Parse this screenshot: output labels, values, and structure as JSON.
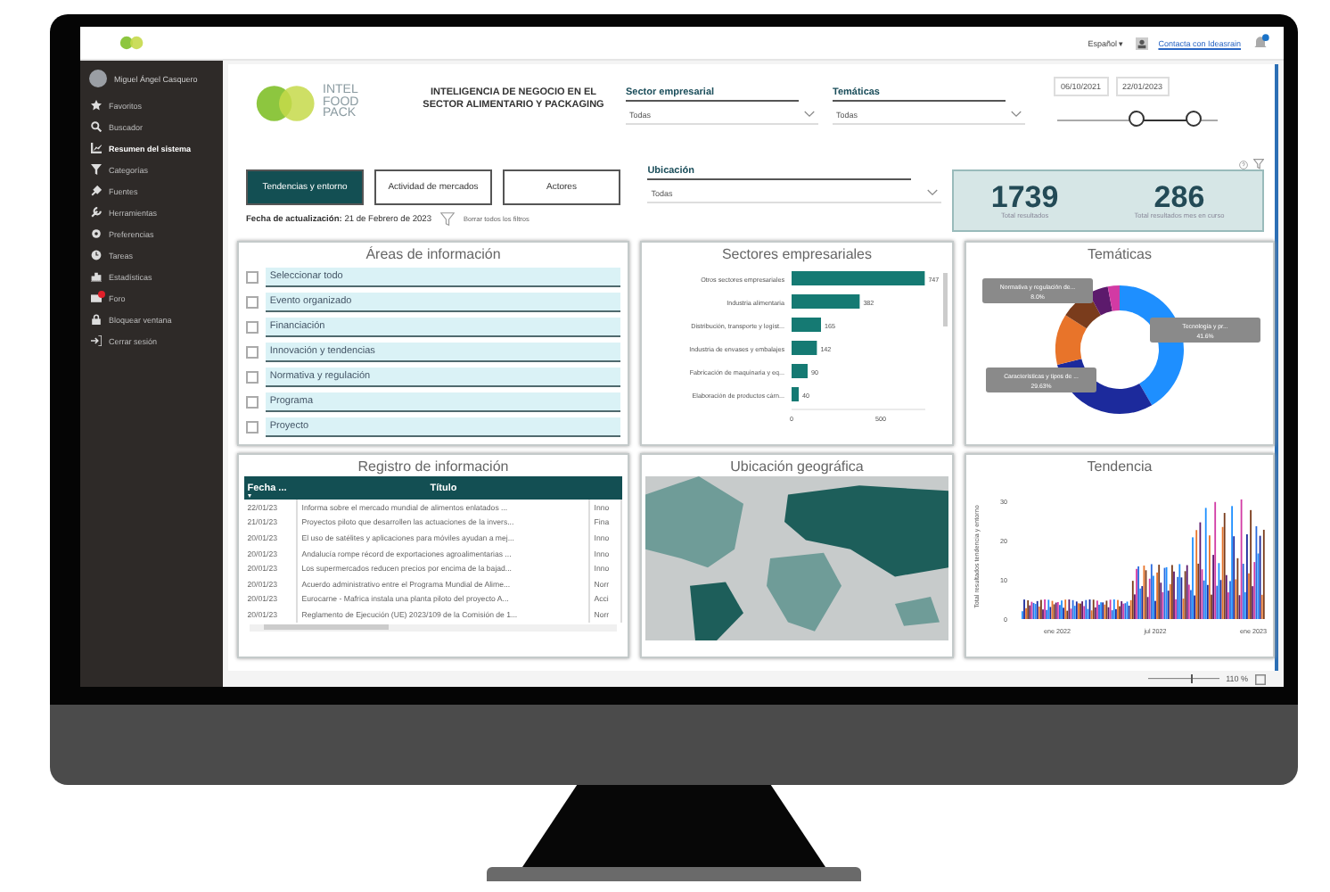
{
  "topbar": {
    "language": "Español ▾",
    "contact_link": "Contacta con Ideasrain",
    "notification_badge": true
  },
  "sidebar": {
    "user": "Miguel Ángel Casquero",
    "items": [
      {
        "label": "Favoritos",
        "selected": false,
        "badge": false
      },
      {
        "label": "Buscador",
        "selected": false,
        "badge": false
      },
      {
        "label": "Resumen del sistema",
        "selected": true,
        "badge": false
      },
      {
        "label": "Categorías",
        "selected": false,
        "badge": false
      },
      {
        "label": "Fuentes",
        "selected": false,
        "badge": false
      },
      {
        "label": "Herramientas",
        "selected": false,
        "badge": false
      },
      {
        "label": "Preferencias",
        "selected": false,
        "badge": false
      },
      {
        "label": "Tareas",
        "selected": false,
        "badge": false
      },
      {
        "label": "Estadísticas",
        "selected": false,
        "badge": false
      },
      {
        "label": "Foro",
        "selected": false,
        "badge": true
      },
      {
        "label": "Bloquear ventana",
        "selected": false,
        "badge": false
      },
      {
        "label": "Cerrar sesión",
        "selected": false,
        "badge": false
      }
    ]
  },
  "report": {
    "logo_lines": [
      "INTEL",
      "FOOD",
      "PACK"
    ],
    "title": "INTELIGENCIA DE NEGOCIO EN EL SECTOR ALIMENTARIO Y PACKAGING",
    "filters": [
      {
        "label": "Sector empresarial",
        "value": "Todas"
      },
      {
        "label": "Temáticas",
        "value": "Todas"
      }
    ],
    "date_range": {
      "from": "06/10/2021",
      "to": "22/01/2023",
      "thumbs": [
        {
          "level": 0.5
        },
        {
          "level": 0.86
        }
      ]
    },
    "tabs": [
      {
        "label": "Tendencias y entorno",
        "selected": true
      },
      {
        "label": "Actividad de mercados",
        "selected": false
      },
      {
        "label": "Actores",
        "selected": false
      }
    ],
    "location_filter": {
      "label": "Ubicación",
      "value": "Todas"
    },
    "kpis": [
      {
        "value": "1739",
        "label": "Total resultados"
      },
      {
        "value": "286",
        "label": "Total resultados mes en curso"
      }
    ],
    "update_date": "**Fecha de actualización:** 21 de Febrero de 2023",
    "clear_filters": "Borrar todos los filtros",
    "areas": {
      "title": "Áreas de información",
      "items": [
        {
          "label": "Seleccionar todo",
          "checked": false
        },
        {
          "label": "Evento organizado",
          "checked": false
        },
        {
          "label": "Financiación",
          "checked": false
        },
        {
          "label": "Innovación y tendencias",
          "checked": false
        },
        {
          "label": "Normativa y regulación",
          "checked": false
        },
        {
          "label": "Programa",
          "checked": false
        },
        {
          "label": "Proyecto",
          "checked": false
        }
      ]
    },
    "sectors": {
      "title": "Sectores empresariales",
      "chart_data": {
        "type": "bar",
        "orientation": "horizontal",
        "categories": [
          "Otros sectores empresariales",
          "Industria alimentaria",
          "Distribución, transporte y logíst...",
          "Industria de envases y embalajes",
          "Fabricación de maquinaria y eq...",
          "Elaboración de productos cárn..."
        ],
        "values": [
          747,
          382,
          165,
          142,
          90,
          40
        ],
        "xlim": [
          0,
          750
        ],
        "xticks": [
          0,
          500
        ],
        "data_labels": true
      }
    },
    "topics": {
      "title": "Temáticas",
      "chart_data": {
        "type": "donut",
        "categories": [
          "Tecnología y pr...",
          "Características y tipos de ...",
          null,
          "Normativa y regulación de...",
          null,
          null
        ],
        "values": [
          41.6,
          29.63,
          12.8,
          8.0,
          5.0,
          2.97
        ],
        "value_labels": [
          "41.6%",
          "29.63%",
          null,
          "8.0%",
          null,
          null
        ]
      }
    },
    "register": {
      "title": "Registro de información",
      "columns": [
        "Fecha ...",
        "Título"
      ],
      "rows": [
        [
          "22/01/23",
          "Informa sobre el mercado mundial de alimentos enlatados ...",
          "Inno"
        ],
        [
          "21/01/23",
          "Proyectos piloto que desarrollen las actuaciones de la invers...",
          "Fina"
        ],
        [
          "20/01/23",
          "El uso de satélites y aplicaciones para móviles ayudan a mej...",
          "Inno"
        ],
        [
          "20/01/23",
          "Andalucía rompe récord de exportaciones agroalimentarias ...",
          "Inno"
        ],
        [
          "20/01/23",
          "Los supermercados reducen precios por encima de la bajad...",
          "Inno"
        ],
        [
          "20/01/23",
          "Acuerdo administrativo entre el Programa Mundial de Alime...",
          "Norr"
        ],
        [
          "20/01/23",
          "Eurocarne - Mafrica instala una planta piloto del proyecto A...",
          "Acci"
        ],
        [
          "20/01/23",
          "Reglamento de Ejecución (UE) 2023/109 de la Comisión de 1...",
          "Norr"
        ]
      ]
    },
    "map": {
      "title": "Ubicación geográfica"
    },
    "trend": {
      "title": "Tendencia",
      "ylabel": "Total resultados tendencia y entorno",
      "yticks": [
        "30",
        "20",
        "10",
        "0"
      ],
      "xticks": [
        "ene 2022",
        "jul 2022",
        "ene 2023"
      ]
    },
    "zoom": "110 %",
    "zoom_slider": {
      "level": 0.6
    }
  }
}
